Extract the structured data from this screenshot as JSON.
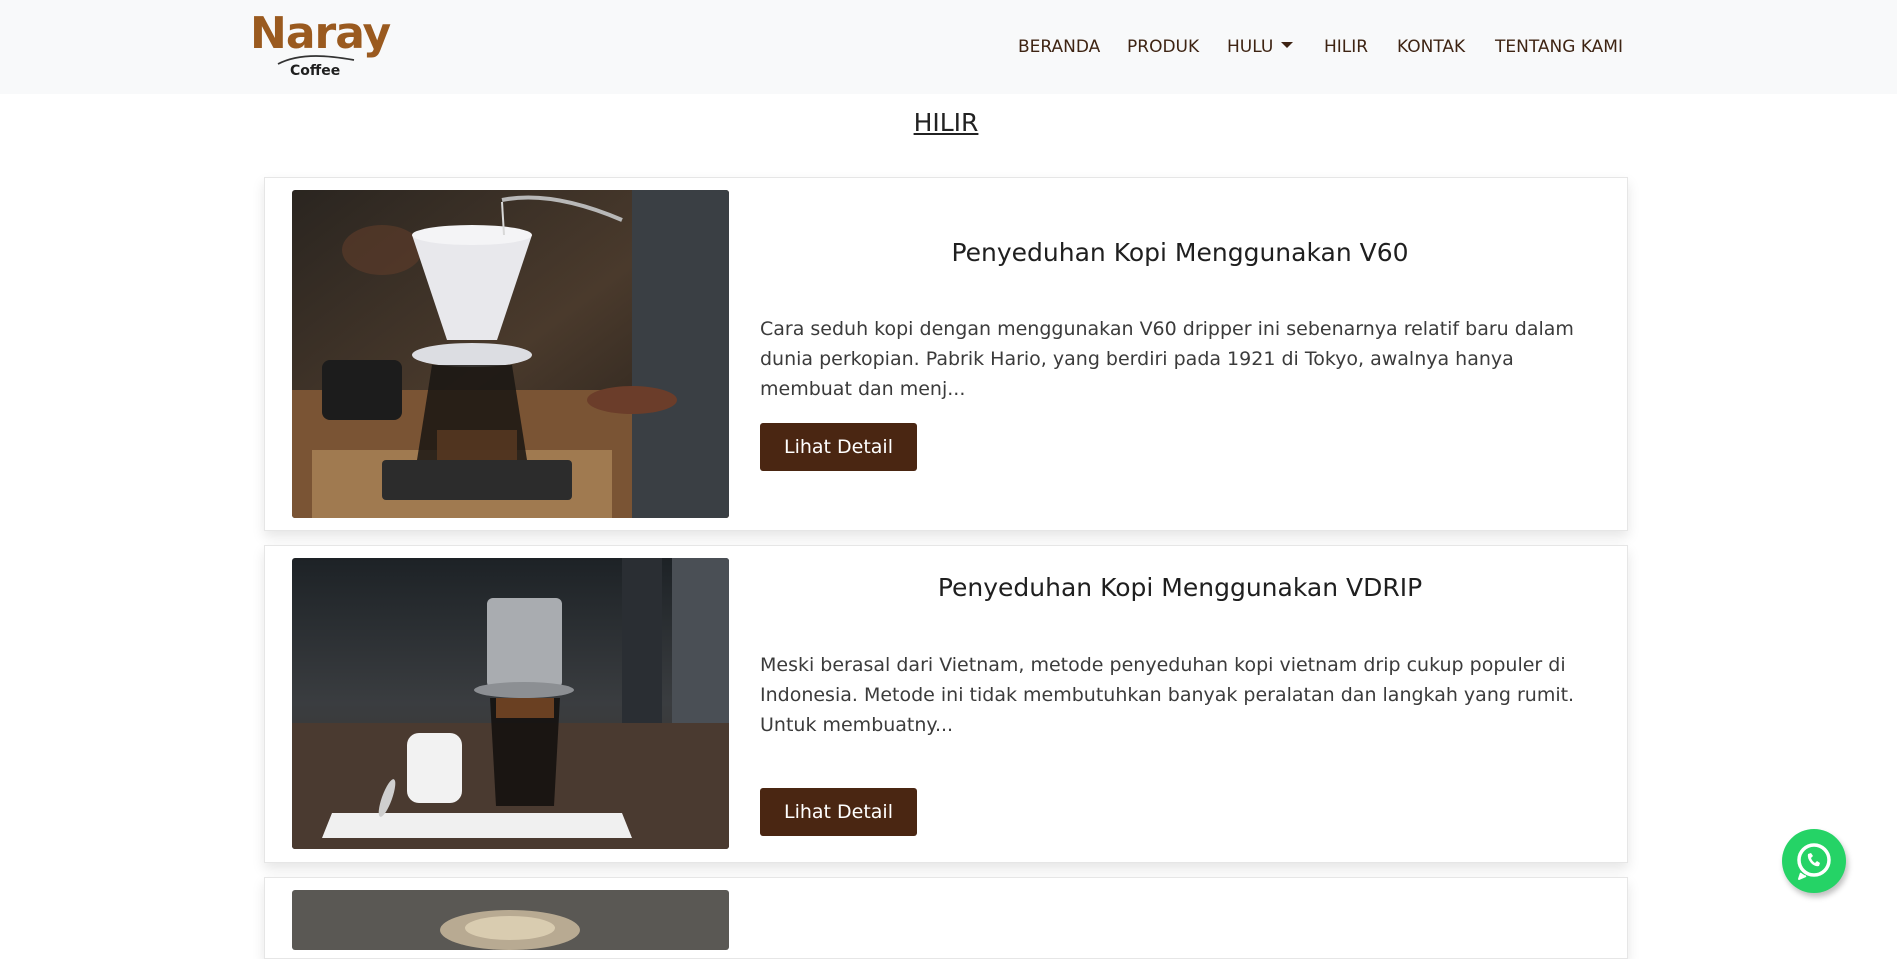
{
  "brand": {
    "name": "Naray",
    "sub": "Coffee",
    "color": "#9a5a1f"
  },
  "nav": {
    "items": [
      "BERANDA",
      "PRODUK",
      "HULU",
      "HILIR",
      "KONTAK",
      "TENTANG KAMI"
    ]
  },
  "page": {
    "title": "HILIR"
  },
  "cards": [
    {
      "title": "Penyeduhan Kopi Menggunakan V60",
      "description": "Cara seduh kopi dengan menggunakan V60 dripper ini sebenarnya relatif baru dalam dunia perkopian. Pabrik Hario, yang berdiri pada 1921 di Tokyo, awalnya hanya membuat dan menj...",
      "button": "Lihat Detail"
    },
    {
      "title": "Penyeduhan Kopi Menggunakan VDRIP",
      "description": "Meski berasal dari Vietnam, metode penyeduhan kopi vietnam drip cukup populer di Indonesia. Metode ini tidak membutuhkan banyak peralatan dan langkah yang rumit. Untuk membuatny...",
      "button": "Lihat Detail"
    }
  ],
  "colors": {
    "button": "#4a2612",
    "nav_text": "#3e2413",
    "whatsapp": "#25d366",
    "navbar_bg": "#f8f9fa"
  },
  "icons": {
    "whatsapp": "whatsapp-icon",
    "dropdown": "caret-down-icon"
  }
}
